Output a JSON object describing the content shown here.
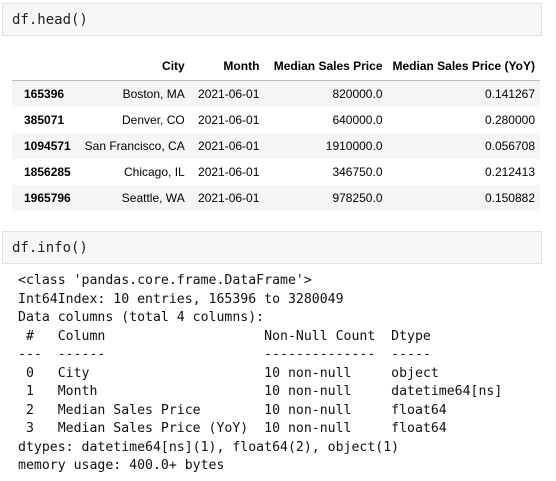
{
  "cells": [
    {
      "code": "df.head()"
    },
    {
      "code": "df.info()"
    }
  ],
  "dataframe": {
    "columns": [
      "",
      "City",
      "Month",
      "Median Sales Price",
      "Median Sales Price (YoY)"
    ],
    "rows": [
      {
        "index": "165396",
        "city": "Boston, MA",
        "month": "2021-06-01",
        "msp": "820000.0",
        "yoy": "0.141267"
      },
      {
        "index": "385071",
        "city": "Denver, CO",
        "month": "2021-06-01",
        "msp": "640000.0",
        "yoy": "0.280000"
      },
      {
        "index": "1094571",
        "city": "San Francisco, CA",
        "month": "2021-06-01",
        "msp": "1910000.0",
        "yoy": "0.056708"
      },
      {
        "index": "1856285",
        "city": "Chicago, IL",
        "month": "2021-06-01",
        "msp": "346750.0",
        "yoy": "0.212413"
      },
      {
        "index": "1965796",
        "city": "Seattle, WA",
        "month": "2021-06-01",
        "msp": "978250.0",
        "yoy": "0.150882"
      }
    ]
  },
  "info_output": {
    "lines": [
      "<class 'pandas.core.frame.DataFrame'>",
      "Int64Index: 10 entries, 165396 to 3280049",
      "Data columns (total 4 columns):",
      " #   Column                    Non-Null Count  Dtype",
      "---  ------                    --------------  -----",
      " 0   City                      10 non-null     object",
      " 1   Month                     10 non-null     datetime64[ns]",
      " 2   Median Sales Price        10 non-null     float64",
      " 3   Median Sales Price (YoY)  10 non-null     float64",
      "dtypes: datetime64[ns](1), float64(2), object(1)",
      "memory usage: 400.0+ bytes"
    ]
  }
}
